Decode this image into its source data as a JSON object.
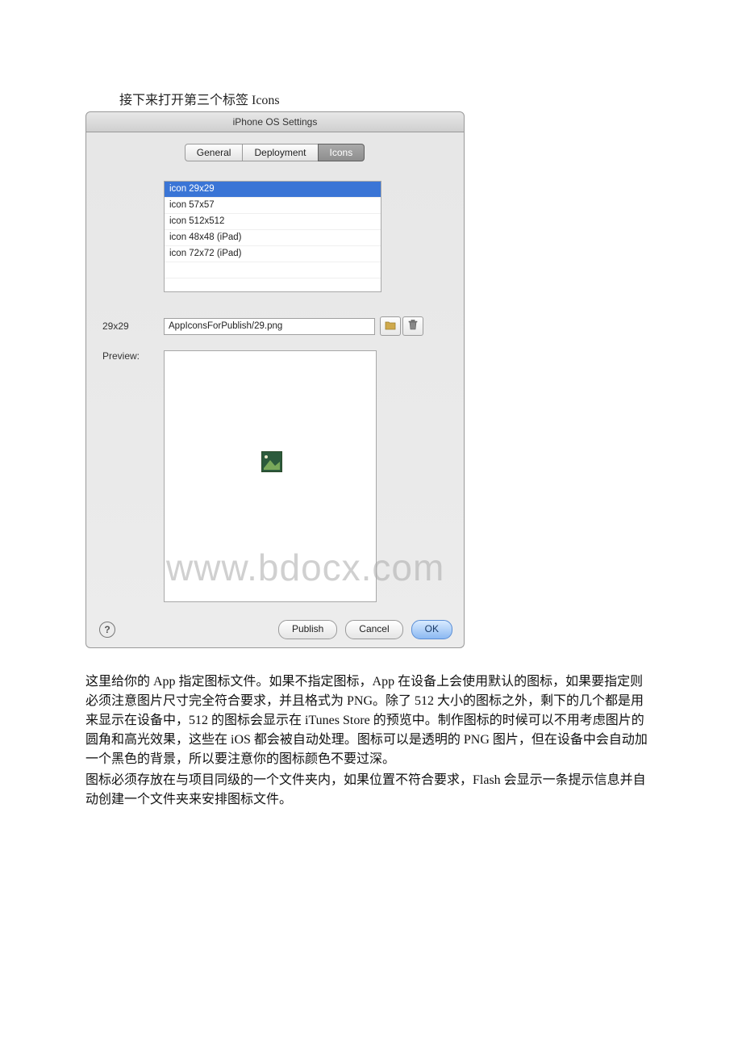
{
  "caption": "接下来打开第三个标签 Icons",
  "dialog": {
    "title": "iPhone OS Settings",
    "tabs": {
      "general": "General",
      "deployment": "Deployment",
      "icons": "Icons"
    },
    "icon_list": [
      "icon 29x29",
      "icon 57x57",
      "icon 512x512",
      "icon 48x48 (iPad)",
      "icon 72x72 (iPad)"
    ],
    "size_label": "29x29",
    "path_value": "AppIconsForPublish/29.png",
    "preview_label": "Preview:",
    "buttons": {
      "publish": "Publish",
      "cancel": "Cancel",
      "ok": "OK"
    },
    "help_glyph": "?"
  },
  "watermark": "www.bdocx.com",
  "article": {
    "p1": "这里给你的 App 指定图标文件。如果不指定图标，App 在设备上会使用默认的图标，如果要指定则必须注意图片尺寸完全符合要求，并且格式为 PNG。除了 512 大小的图标之外，剩下的几个都是用来显示在设备中，512 的图标会显示在 iTunes Store 的预览中。制作图标的时候可以不用考虑图片的圆角和高光效果，这些在 iOS 都会被自动处理。图标可以是透明的 PNG 图片，但在设备中会自动加一个黑色的背景，所以要注意你的图标颜色不要过深。",
    "p2": "图标必须存放在与项目同级的一个文件夹内，如果位置不符合要求，Flash 会显示一条提示信息并自动创建一个文件夹来安排图标文件。"
  }
}
